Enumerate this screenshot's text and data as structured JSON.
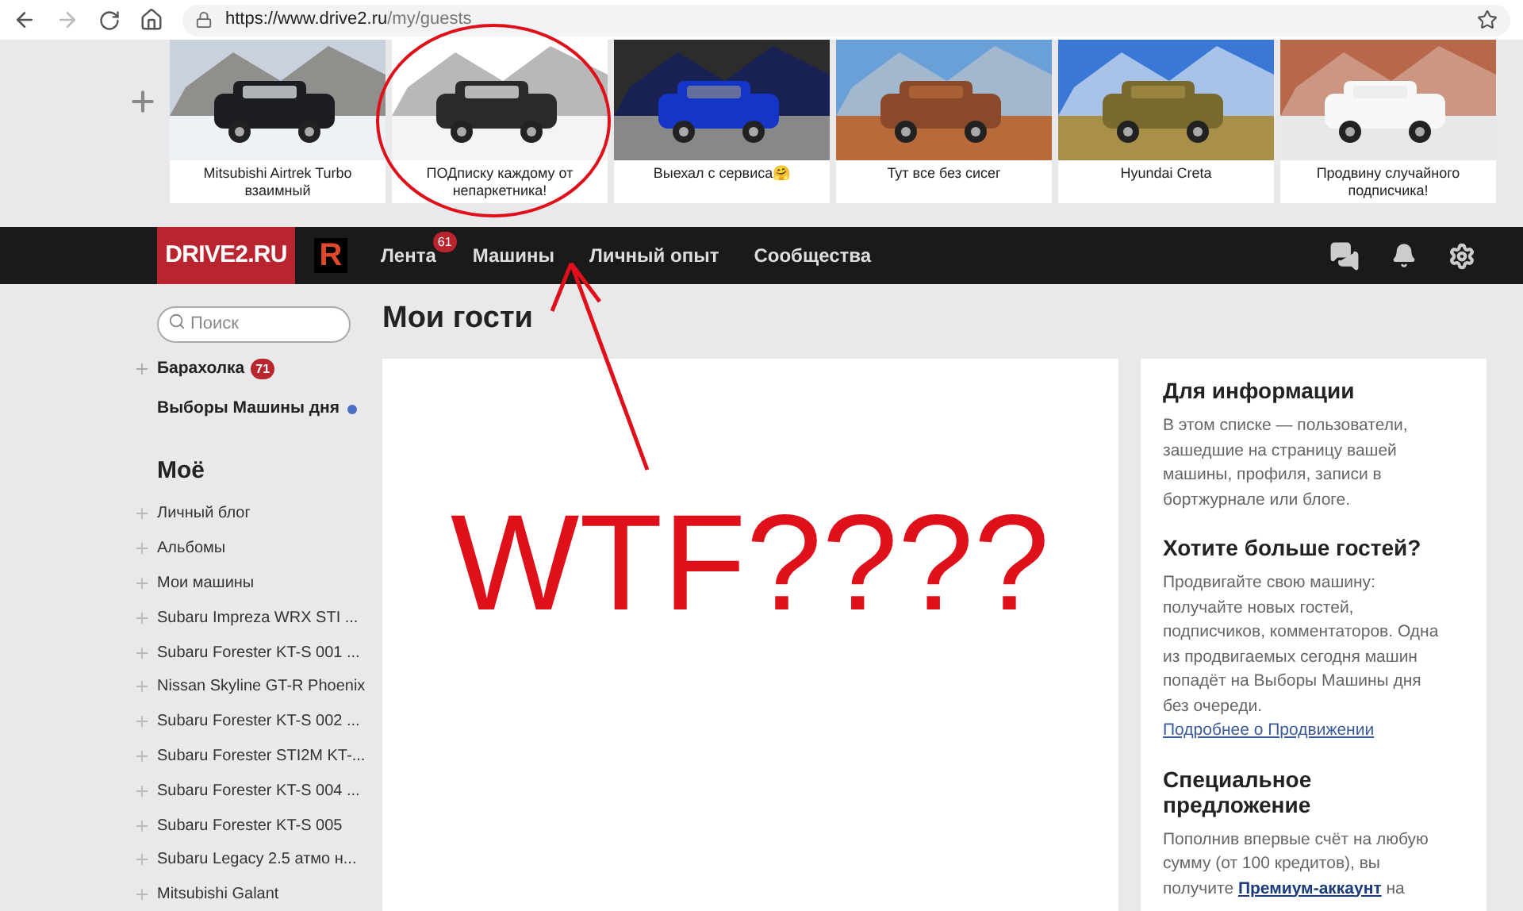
{
  "browser": {
    "url_host": "https://www.drive2.ru",
    "url_path": "/my/guests"
  },
  "guests": [
    {
      "caption": "Mitsubishi Airtrek Turbo взаимный",
      "kind": "picture"
    },
    {
      "caption": "ПОДписку каждому от непаркетника!",
      "kind": "picture"
    },
    {
      "caption": "Выехал с сервиса🤗",
      "kind": "picture"
    },
    {
      "caption": "Тут все без сисег",
      "kind": "picture"
    },
    {
      "caption": "Hyundai Creta",
      "kind": "picture"
    },
    {
      "caption": "Продвину случайного подписчика!",
      "kind": "picture"
    }
  ],
  "nav": {
    "logo": "DRIVE2.RU",
    "logo_mark": "R",
    "items": [
      {
        "label": "Лента",
        "badge": "61"
      },
      {
        "label": "Машины"
      },
      {
        "label": "Личный опыт"
      },
      {
        "label": "Сообщества"
      }
    ]
  },
  "sidebar": {
    "search_placeholder": "Поиск",
    "top_items": [
      {
        "label": "Барахолка",
        "badge": "71",
        "dot": false,
        "plus": true
      },
      {
        "label": "Выборы Машины дня",
        "dot": true,
        "plus": false
      }
    ],
    "section_title": "Моё",
    "items": [
      "Личный блог",
      "Альбомы",
      "Мои машины",
      "Subaru Impreza WRX STI ...",
      "Subaru Forester KT-S 001 ...",
      "Nissan Skyline GT-R Phoenix",
      "Subaru Forester KT-S 002 ...",
      "Subaru Forester STI2M KT-...",
      "Subaru Forester KT-S 004 ...",
      "Subaru Forester KT-S 005",
      "Subaru Legacy 2.5 атмо н...",
      "Mitsubishi Galant"
    ]
  },
  "page_title": "Мои гости",
  "info": [
    {
      "title": "Для информации",
      "text": "В этом списке — пользователи, зашедшие на страницу вашей машины, профиля, записи в бортжурнале или блоге."
    },
    {
      "title": "Хотите больше гостей?",
      "text": "Продвигайте свою машину: получайте новых гостей, подписчиков, комментаторов. Одна из продвигаемых сегодня машин попадёт на Выборы Машины дня без очереди.",
      "link": "Подробнее о Продвижении"
    },
    {
      "title": "Специальное предложение",
      "text_before": "Пополнив впервые счёт на любую сумму (от 100 кредитов), вы получите ",
      "strong_link": "Премиум-аккаунт",
      "text_after": " на"
    }
  ],
  "annotation": {
    "text": "WTF????"
  }
}
